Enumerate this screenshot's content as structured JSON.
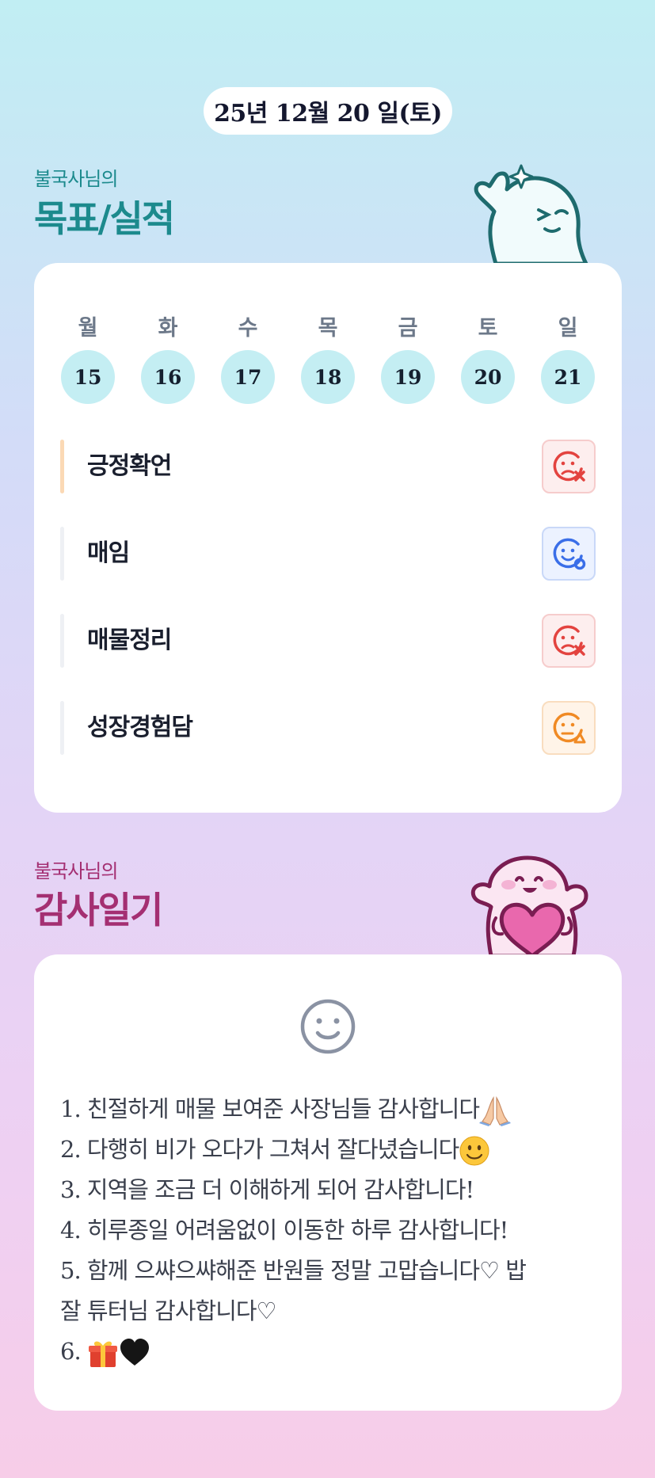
{
  "date_label": "25년 12월 20 일(토)",
  "goals_section": {
    "subtitle": "불국사님의",
    "title": "목표/실적"
  },
  "week": {
    "weekdays": [
      "월",
      "화",
      "수",
      "목",
      "금",
      "토",
      "일"
    ],
    "days": [
      "15",
      "16",
      "17",
      "18",
      "19",
      "20",
      "21"
    ]
  },
  "goals": [
    {
      "label": "긍정확언",
      "status": "fail",
      "icon": "sad-face-x-icon",
      "accent": true
    },
    {
      "label": "매임",
      "status": "done",
      "icon": "smile-face-check-icon",
      "accent": false
    },
    {
      "label": "매물정리",
      "status": "fail",
      "icon": "sad-face-x-icon",
      "accent": false
    },
    {
      "label": "성장경험담",
      "status": "partial",
      "icon": "neutral-face-triangle-icon",
      "accent": false
    }
  ],
  "diary_section": {
    "subtitle": "불국사님의",
    "title": "감사일기"
  },
  "diary": {
    "icon": "smile-icon",
    "lines": [
      "1. 친절하게 매물 보여준 사장님들 감사합니다",
      "2. 다행히 비가 오다가 그쳐서 잘다녔습니다",
      "3. 지역을 조금 더 이해하게 되어 감사합니다!",
      "4. 히루종일 어려움없이 이동한 하루 감사합니다!",
      "5. 함께 으쌰으쌰해준 반원들 정말 고맙습니다♡ 밥",
      "잘 튜터님 감사합니다♡",
      "6. "
    ]
  },
  "colors": {
    "teal": "#1c8a8d",
    "magenta": "#a42f72",
    "fail": "#e3433f",
    "done": "#3a6ee8",
    "partial": "#f08a24",
    "day_circle": "#c4eef3"
  }
}
